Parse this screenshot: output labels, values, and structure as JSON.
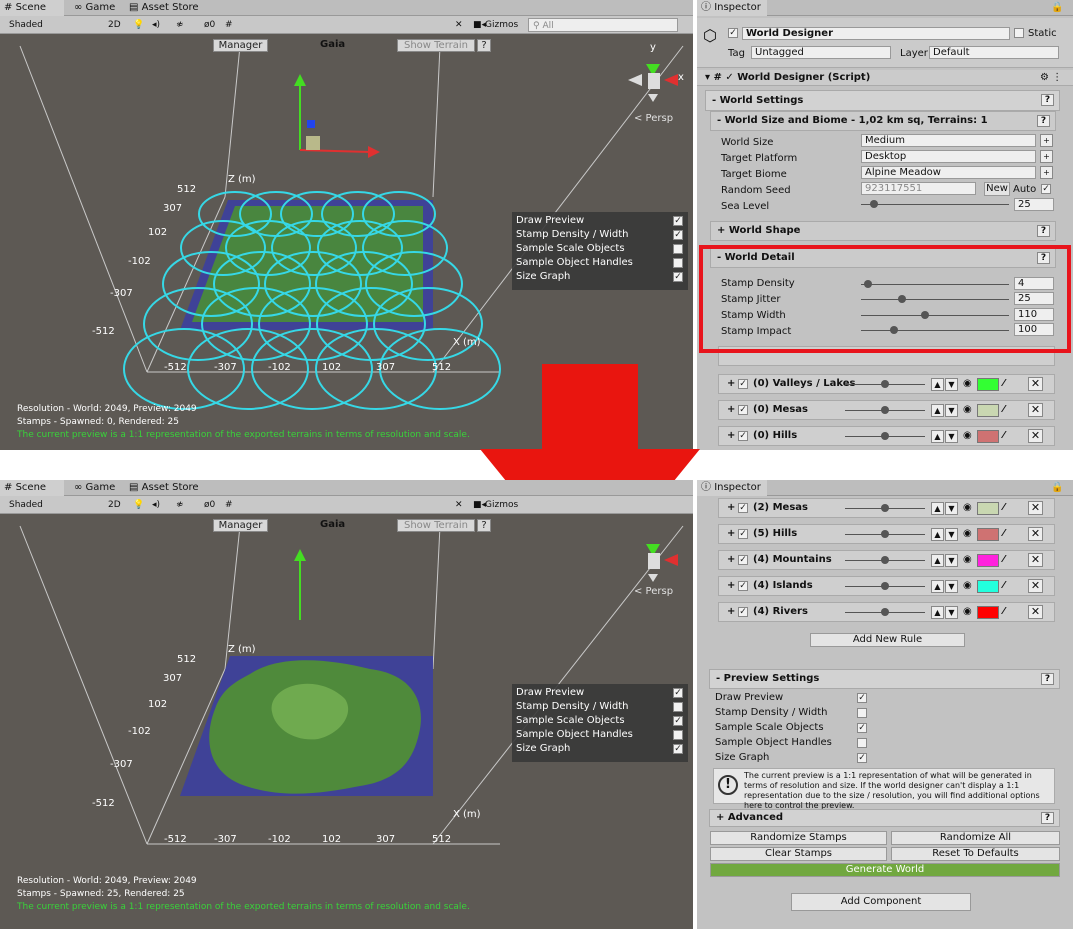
{
  "scene_tabs": {
    "scene": "Scene",
    "game": "Game",
    "asset_store": "Asset Store"
  },
  "scene_toolbar": {
    "shading": "Shaded",
    "mode_2d": "2D",
    "gizmo_count": "0",
    "gizmos": "Gizmos",
    "search_placeholder": "All"
  },
  "scene_header": {
    "manager": "Manager",
    "title": "Gaia",
    "show_terrain": "Show Terrain",
    "help": "?"
  },
  "persp": "< Persp",
  "gizmo_axes": {
    "x": "x",
    "y": "y"
  },
  "axis_labels": {
    "z": "Z (m)",
    "x": "X (m)",
    "ticks_v": [
      "512",
      "307",
      "102",
      "-102",
      "-307",
      "-512"
    ],
    "ticks_h": [
      "-512",
      "-307",
      "-102",
      "102",
      "307",
      "512"
    ]
  },
  "overlay": {
    "draw_preview": "Draw Preview",
    "density_width": "Stamp Density / Width",
    "sample_scale": "Sample Scale Objects",
    "sample_handles": "Sample Object Handles",
    "size_graph": "Size Graph"
  },
  "top": {
    "overlay_checks": [
      true,
      true,
      false,
      false,
      true
    ],
    "status": {
      "resolution": "Resolution - World: 2049, Preview: 2049",
      "stamps": "Stamps - Spawned: 0, Rendered: 25",
      "note": "The current preview is a 1:1 representation of the exported terrains in terms of resolution and scale."
    }
  },
  "bottom": {
    "overlay_checks": [
      true,
      false,
      true,
      false,
      true
    ],
    "status": {
      "resolution": "Resolution - World: 2049, Preview: 2049",
      "stamps": "Stamps - Spawned: 25, Rendered: 25",
      "note": "The current preview is a 1:1 representation of the exported terrains in terms of resolution and scale."
    }
  },
  "inspector": {
    "tab": "Inspector",
    "object_name": "World Designer",
    "static": "Static",
    "tag_label": "Tag",
    "tag_value": "Untagged",
    "layer_label": "Layer",
    "layer_value": "Default",
    "script": "World Designer (Script)"
  },
  "world_settings": {
    "title": "- World Settings",
    "size_biome": "- World Size and Biome - 1,02 km sq, Terrains: 1",
    "world_size_label": "World Size",
    "world_size": "Medium",
    "platform_label": "Target Platform",
    "platform": "Desktop",
    "biome_label": "Target Biome",
    "biome": "Alpine Meadow",
    "seed_label": "Random Seed",
    "seed": "923117551",
    "new": "New",
    "auto": "Auto",
    "sea_label": "Sea Level",
    "sea": "25"
  },
  "world_shape": "+ World Shape",
  "world_detail": {
    "title": "- World Detail",
    "density_label": "Stamp Density",
    "density": "4",
    "density_level": 0.05,
    "jitter_label": "Stamp Jitter",
    "jitter": "25",
    "jitter_level": 0.28,
    "width_label": "Stamp Width",
    "width": "110",
    "width_level": 0.43,
    "impact_label": "Stamp Impact",
    "impact": "100",
    "impact_level": 0.22
  },
  "top_rules": [
    {
      "label": "(0) Valleys / Lakes",
      "color": "#33ff33"
    },
    {
      "label": "(0) Mesas",
      "color": "#c9d7b1"
    },
    {
      "label": "(0) Hills",
      "color": "#cf7272"
    }
  ],
  "bottom_rules": [
    {
      "label": "(2) Mesas",
      "color": "#c9d7b1"
    },
    {
      "label": "(5) Hills",
      "color": "#cf7272"
    },
    {
      "label": "(4) Mountains",
      "color": "#ff22dd"
    },
    {
      "label": "(4) Islands",
      "color": "#22ffdd"
    },
    {
      "label": "(4) Rivers",
      "color": "#ff0000"
    }
  ],
  "add_rule": "Add New Rule",
  "preview_settings": {
    "title": "- Preview Settings",
    "rows": [
      "Draw Preview",
      "Stamp Density / Width",
      "Sample Scale Objects",
      "Sample Object Handles",
      "Size Graph"
    ],
    "checks": [
      true,
      false,
      true,
      false,
      true
    ],
    "info": "The current preview is a 1:1 representation of what will be generated in terms of resolution and size. If the world designer can't display a 1:1 representation due to the size / resolution, you will find additional options here to control the preview."
  },
  "advanced": "+ Advanced",
  "actions": {
    "randomize_stamps": "Randomize Stamps",
    "randomize_all": "Randomize All",
    "clear_stamps": "Clear Stamps",
    "reset": "Reset To Defaults",
    "generate": "Generate World",
    "add_component": "Add Component"
  },
  "colors": {
    "highlight": "#e8141c",
    "arrow": "#e9150f",
    "generate": "#71a83f",
    "cyan": "#36d8e6",
    "terrain_blue": "#3c3f9e"
  }
}
